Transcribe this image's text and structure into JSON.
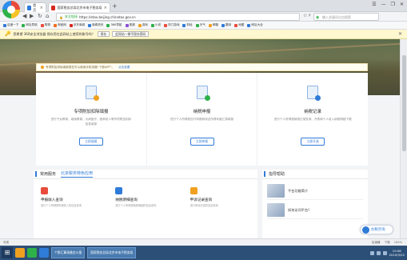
{
  "browser": {
    "tabs": [
      {
        "label": "首页"
      },
      {
        "label": "国家税务总局北京市电子税务局 - 自然人办税服务平台"
      }
    ],
    "new_tab": "+",
    "window_controls": [
      "☰",
      "—",
      "❐",
      "✕"
    ],
    "nav": {
      "back": "◀",
      "forward": "▶",
      "refresh": "↻",
      "home": "⌂"
    },
    "url": {
      "secure_label": "安全链接",
      "address": "https://etax.beijing.chinatax.gov.cn"
    },
    "search_placeholder": "输入关键词点击搜索",
    "url_actions": [
      "☆",
      "⚡"
    ],
    "bookmarks": [
      {
        "label": "百度一下",
        "color": "#2f7bd8"
      },
      {
        "label": "网址导航",
        "color": "#2fb14a"
      },
      {
        "label": "购物",
        "color": "#e84b3c"
      },
      {
        "label": "淘宝网",
        "color": "#f26c21"
      },
      {
        "label": "京东商城",
        "color": "#d7281f"
      },
      {
        "label": "新闻资讯",
        "color": "#2f7bd8"
      },
      {
        "label": "360导航",
        "color": "#2fb14a"
      },
      {
        "label": "视频",
        "color": "#8b4fd6"
      },
      {
        "label": "游戏",
        "color": "#f0a020"
      },
      {
        "label": "小说",
        "color": "#2fb14a"
      },
      {
        "label": "热门游戏",
        "color": "#e84b3c"
      },
      {
        "label": "财经",
        "color": "#2f7bd8"
      },
      {
        "label": "天气",
        "color": "#2fb14a"
      },
      {
        "label": "邮箱",
        "color": "#f0a020"
      },
      {
        "label": "翻译",
        "color": "#2f7bd8"
      },
      {
        "label": "地图",
        "color": "#e84b3c"
      },
      {
        "label": "网址大全",
        "color": "#2f7bd8"
      }
    ],
    "password_bar": {
      "text": "您希望 360安全浏览器 保存您在此网站上使用的账号吗？",
      "save": "保存",
      "never": "此网站一律不保存密码",
      "close": "✕"
    }
  },
  "page": {
    "notice": {
      "text": "专项附加扣除填报现在可以使用手机扣缴“个税APP”。",
      "link": "点击查看"
    },
    "cards": [
      {
        "title": "专项附加扣除填报",
        "desc": "进行子女教育、继续教育、大病医疗、赡养老人等专项附加扣除信息填报",
        "button": "立即填报",
        "badge_color": "#f0a020"
      },
      {
        "title": "纳税申报",
        "desc": "进行个人所得税自行申报和综合所得年度汇算填报",
        "button": "立即申报",
        "badge_color": "#2fb14a"
      },
      {
        "title": "纳税记录",
        "desc": "进行个人所得税纳税记录查询、开具和个人收入纳税明细下载",
        "button": "立即开具",
        "badge_color": "#2f7bd8"
      }
    ],
    "services": {
      "tabs": [
        "常用服务",
        "北京税务特色应用"
      ],
      "items": [
        {
          "name": "申报收入查询",
          "desc": "进行个人所得税申报收入的信息查询",
          "color": "#e84b3c"
        },
        {
          "name": "纳税明细查询",
          "desc": "进行个人所得税纳税明细的信息查询",
          "color": "#2f7bd8"
        },
        {
          "name": "申诉记录查询",
          "desc": "进行申诉记录的信息查询",
          "color": "#f0a020"
        }
      ]
    },
    "help": {
      "title": "指导帮助",
      "items": [
        {
          "label": "平台功能简介"
        },
        {
          "label": "如何访问平台？"
        }
      ]
    },
    "float_help": "办税咨询"
  },
  "statusbar": {
    "left": "完成",
    "right": [
      "加速器",
      "下载",
      "100%"
    ]
  },
  "taskbar": {
    "start": "⊞",
    "apps": [
      {
        "label": "个税汇算清缴怎么报"
      },
      {
        "label": "国家税务总局北京市电子税务局"
      }
    ],
    "clock_time": "10:08",
    "clock_date": "2019/3/22"
  }
}
